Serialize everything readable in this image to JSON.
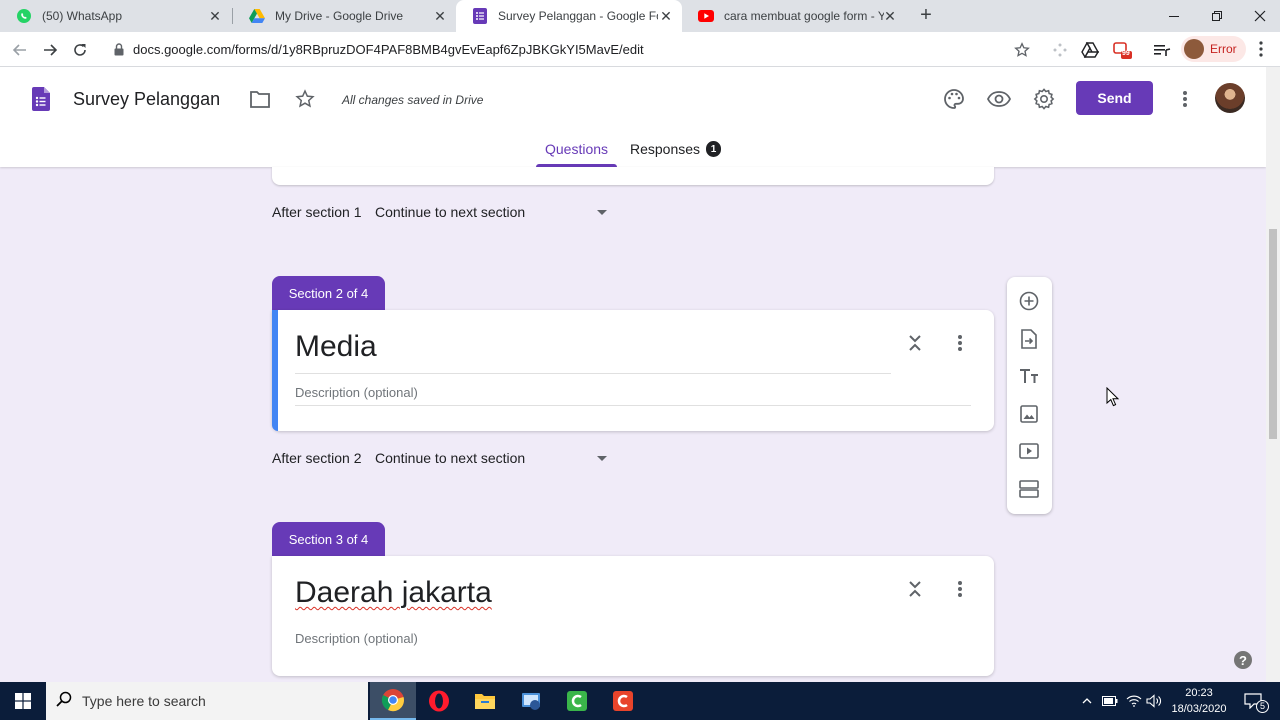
{
  "browser": {
    "tabs": [
      {
        "title": "(50) WhatsApp",
        "icon": "whatsapp-icon"
      },
      {
        "title": "My Drive - Google Drive",
        "icon": "google-drive-icon"
      },
      {
        "title": "Survey Pelanggan - Google Forms",
        "icon": "google-forms-icon"
      },
      {
        "title": "cara membuat google form - YouTube",
        "icon": "youtube-icon"
      }
    ],
    "url": "docs.google.com/forms/d/1y8RBpruzDOF4PAF8BMB4gvEvEapf6ZpJBKGkYI5MavE/edit",
    "profile_status": "Error",
    "extension_badge": "99"
  },
  "form": {
    "title": "Survey Pelanggan",
    "save_status": "All changes saved in Drive",
    "send_label": "Send",
    "tabs": {
      "questions": "Questions",
      "responses": "Responses",
      "responses_count": "1"
    },
    "sections": [
      {
        "after_label": "After section 1",
        "after_value": "Continue to next section"
      },
      {
        "badge": "Section 2 of 4",
        "title": "Media",
        "description_placeholder": "Description (optional)",
        "after_label": "After section 2",
        "after_value": "Continue to next section"
      },
      {
        "badge": "Section 3 of 4",
        "title": "Daerah jakarta",
        "description_placeholder": "Description (optional)"
      }
    ],
    "accent_color": "#673ab7",
    "focus_color": "#4285f4",
    "background_color": "#f0ebf8"
  },
  "help": "?",
  "taskbar": {
    "search_placeholder": "Type here to search",
    "time": "20:23",
    "date": "18/03/2020",
    "notification_count": "5",
    "apps": [
      "chrome-icon",
      "opera-icon",
      "file-explorer-icon",
      "app-icon",
      "camtasia-icon",
      "camtasia-recorder-icon"
    ]
  }
}
